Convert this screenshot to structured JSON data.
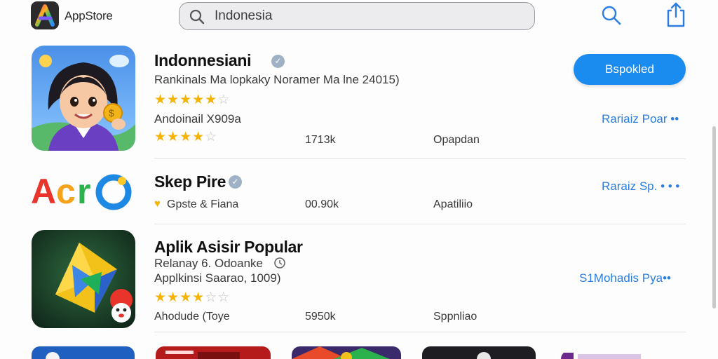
{
  "header": {
    "app_name": "AppStore",
    "search": {
      "value": "",
      "placeholder": "Indonesia"
    },
    "icons": {
      "logo": "rainbow-a-logo",
      "search": "search-icon",
      "share": "share-icon"
    }
  },
  "apps": [
    {
      "title": "Indonnesiani",
      "subtitle": "Rankinals Ma lopkaky Noramer Ma lne 24015)",
      "category": "Andoinail X909a",
      "rating_top": 4.5,
      "rating_bottom": 4,
      "downloads": "1713k",
      "type": "Opapdan",
      "button_label": "Bspokled",
      "link_label": "Rariaiz Poar ••"
    },
    {
      "title": "Skep Pire",
      "category": "Gpste & Fiana",
      "downloads": "00.90k",
      "type": "Apatiliio",
      "link_label": "Raraiz Sp. • • •"
    },
    {
      "title": "Aplik Asisir Popular",
      "line1": "Relanay 6. Odoanke",
      "line2": "Applkinsi Saarao, 1009)",
      "category": "Ahodude (Toye",
      "rating": 4,
      "downloads": "5950k",
      "type": "Sppnliao",
      "link_label": "S1Mohadis Pya••"
    }
  ],
  "colors": {
    "accent": "#1a8cf0",
    "link": "#2a7de1",
    "star": "#f4b400",
    "verified": "#9fb2c5"
  }
}
